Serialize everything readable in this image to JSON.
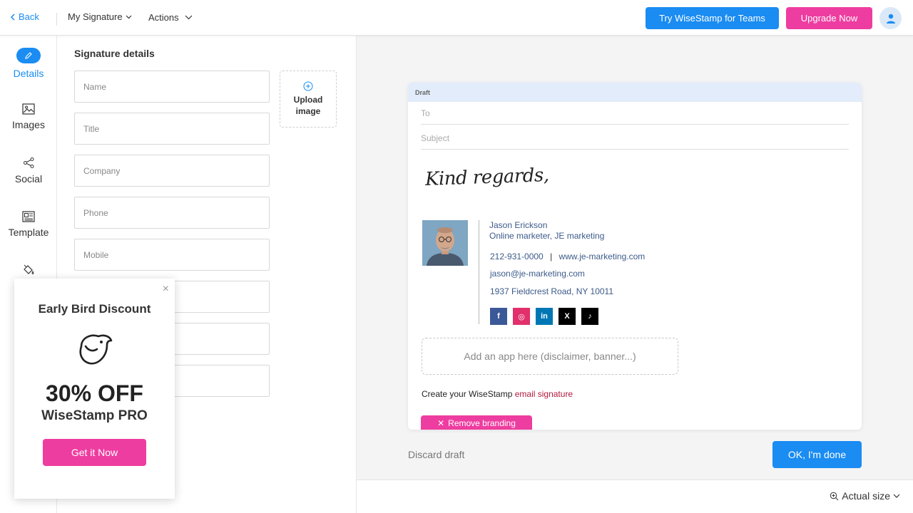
{
  "topbar": {
    "back_label": "Back",
    "signature_menu": "My Signature",
    "actions_menu": "Actions",
    "teams_button": "Try WiseStamp for Teams",
    "upgrade_button": "Upgrade Now"
  },
  "leftnav": {
    "items": [
      {
        "label": "Details",
        "icon": "pencil-icon"
      },
      {
        "label": "Images",
        "icon": "image-icon"
      },
      {
        "label": "Social",
        "icon": "share-icon"
      },
      {
        "label": "Template",
        "icon": "template-icon"
      },
      {
        "label": "",
        "icon": "paint-bucket-icon"
      }
    ]
  },
  "panel": {
    "title": "Signature details",
    "fields": [
      {
        "placeholder": "Name"
      },
      {
        "placeholder": "Title"
      },
      {
        "placeholder": "Company"
      },
      {
        "placeholder": "Phone"
      },
      {
        "placeholder": "Mobile"
      },
      {
        "placeholder": ""
      },
      {
        "placeholder": ""
      },
      {
        "placeholder": ""
      }
    ],
    "upload_label": "Upload image"
  },
  "preview": {
    "header": "Draft",
    "to_label": "To",
    "subject_label": "Subject",
    "closing": "Kind regards,",
    "signature": {
      "name": "Jason Erickson",
      "role": "Online marketer, JE marketing",
      "phone": "212-931-0000",
      "separator": "|",
      "website": "www.je-marketing.com",
      "email": "jason@je-marketing.com",
      "address": "1937 Fieldcrest Road, NY 10011"
    },
    "social": [
      {
        "name": "facebook",
        "glyph": "f",
        "color": "#3b5998"
      },
      {
        "name": "instagram",
        "glyph": "◎",
        "color": "#e1306c"
      },
      {
        "name": "linkedin",
        "glyph": "in",
        "color": "#0077b5"
      },
      {
        "name": "x",
        "glyph": "X",
        "color": "#000000"
      },
      {
        "name": "tiktok",
        "glyph": "♪",
        "color": "#000000"
      }
    ],
    "add_app": "Add an app here (disclaimer, banner...)",
    "branding_text": "Create your WiseStamp",
    "branding_link": "email signature",
    "remove_branding": "Remove branding"
  },
  "footer": {
    "discard": "Discard draft",
    "ok": "OK, I'm done",
    "zoom": "Actual size"
  },
  "promo": {
    "title": "Early Bird Discount",
    "discount": "30% OFF",
    "product": "WiseStamp PRO",
    "cta": "Get it Now"
  },
  "colors": {
    "primary": "#1a8cf2",
    "accent": "#ee3da0"
  }
}
